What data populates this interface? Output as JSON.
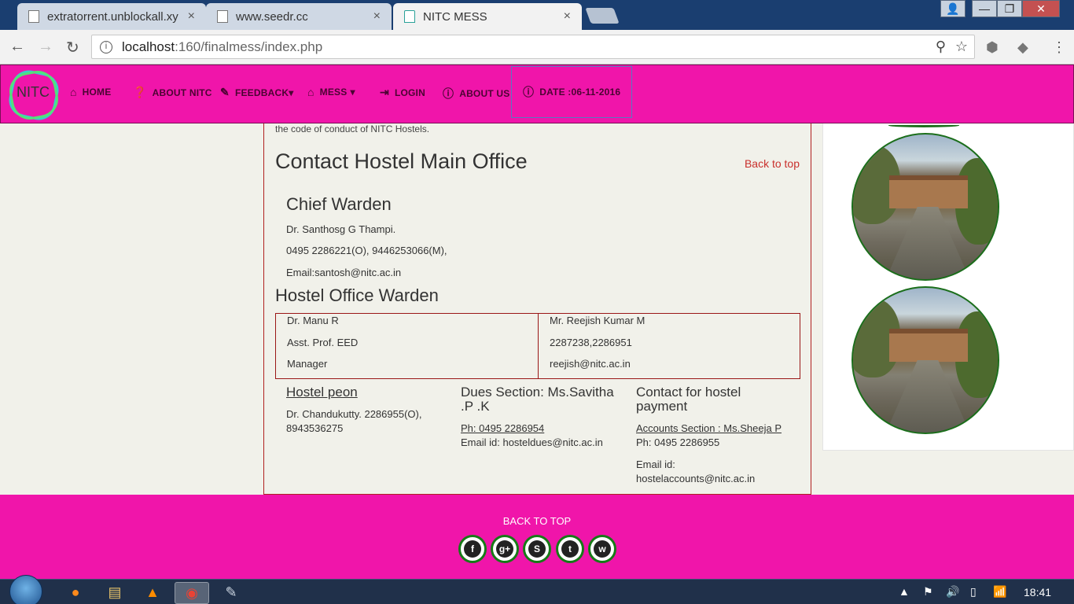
{
  "browser": {
    "tabs": [
      {
        "title": "extratorrent.unblockall.xy",
        "close": "×"
      },
      {
        "title": "www.seedr.cc",
        "close": "×"
      },
      {
        "title": "NITC MESS",
        "close": "×"
      }
    ],
    "url_host": "localhost",
    "url_path": ":160/finalmess/index.php",
    "window_controls": {
      "minimize": "—",
      "maximize": "❐",
      "close": "✕"
    }
  },
  "site": {
    "logo_text": "NITC",
    "nav": [
      {
        "label": "HOME",
        "icon": "home-icon"
      },
      {
        "label": "ABOUT NITC",
        "icon": "question-circle-icon"
      },
      {
        "label": "FEEDBACK",
        "icon": "pencil-icon"
      },
      {
        "label": "MESS",
        "icon": "home-icon"
      },
      {
        "label": "LOGIN",
        "icon": "login-icon"
      },
      {
        "label": "ABOUT US",
        "icon": "info-circle-icon"
      },
      {
        "label": "DATE :06-11-2016",
        "icon": "info-circle-icon"
      }
    ],
    "dropdown_caret": "▾"
  },
  "content": {
    "conduct_text": "the code of conduct of NITC Hostels.",
    "contact_heading": "Contact Hostel Main Office",
    "back_to_top": "Back to top",
    "chief": {
      "heading": "Chief Warden",
      "name": "Dr. Santhosg G Thampi.",
      "phone": "0495 2286221(O), 9446253066(M),",
      "email": "Email:santosh@nitc.ac.in"
    },
    "office": {
      "heading": "Hostel Office Warden",
      "left": [
        "Dr. Manu R",
        "Asst. Prof. EED",
        "Manager"
      ],
      "right": [
        "Mr. Reejish Kumar M",
        "2287238,2286951",
        "reejish@nitc.ac.in"
      ]
    },
    "peon": {
      "heading": "Hostel peon",
      "line1": "Dr. Chandukutty. 2286955(O),",
      "line2": "8943536275"
    },
    "dues": {
      "heading1": "Dues Section: Ms.Savitha",
      "heading2": ".P .K",
      "phone": "Ph: 0495 2286954",
      "email": "Email id: hosteldues@nitc.ac.in"
    },
    "payment": {
      "heading1": "Contact for hostel",
      "heading2": "payment",
      "accounts": "Accounts Section : Ms.Sheeja P",
      "phone": "Ph: 0495 2286955",
      "email_label": "Email id:",
      "email": "hostelaccounts@nitc.ac.in"
    }
  },
  "footer": {
    "back_to_top": "BACK TO TOP",
    "social": [
      {
        "name": "facebook-icon",
        "glyph": "f"
      },
      {
        "name": "google-plus-icon",
        "glyph": "g+"
      },
      {
        "name": "skype-icon",
        "glyph": "S"
      },
      {
        "name": "twitter-icon",
        "glyph": "t"
      },
      {
        "name": "whatsapp-icon",
        "glyph": "w"
      }
    ]
  },
  "taskbar": {
    "clock": "18:41"
  },
  "colors": {
    "brand_pink": "#f015aa",
    "nav_text": "#4b0432",
    "link_red": "#c9302c",
    "border_red": "#b02020",
    "social_ring": "#177a17"
  }
}
